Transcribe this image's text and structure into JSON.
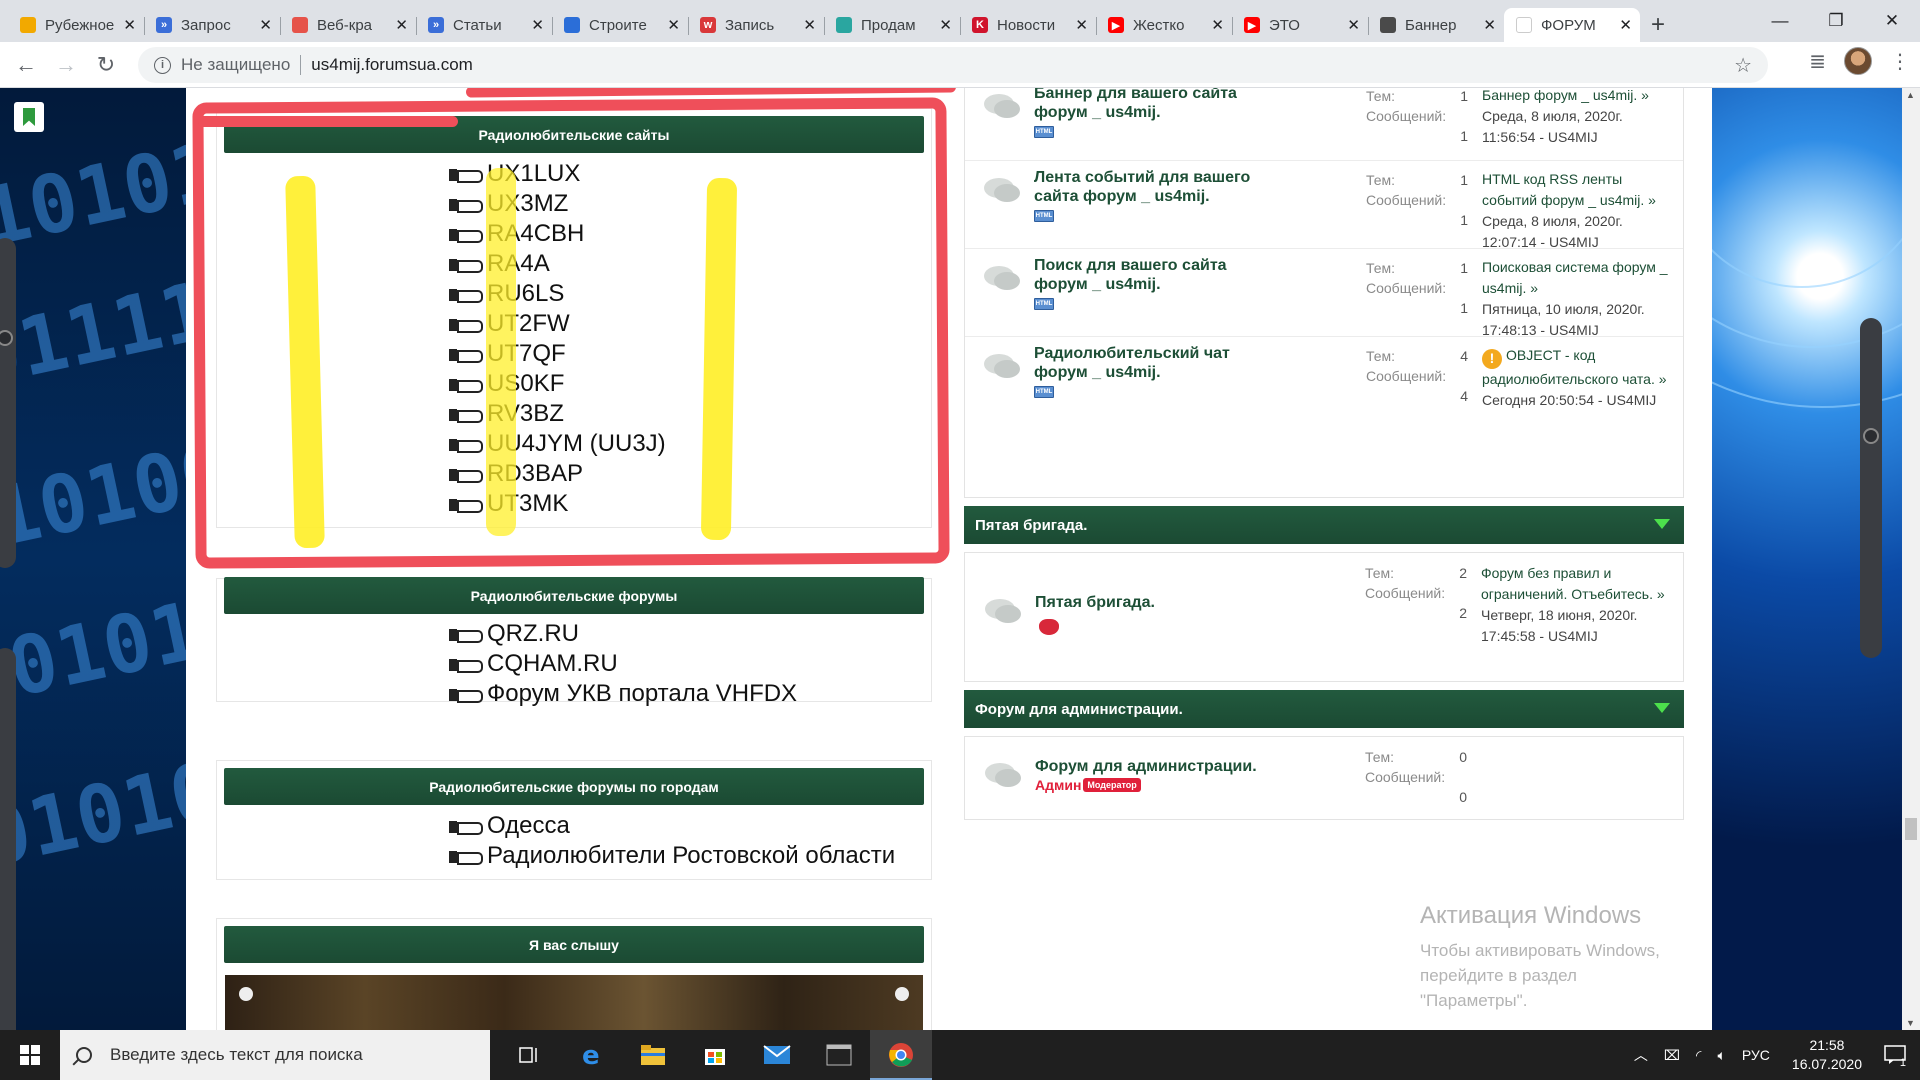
{
  "browser": {
    "tabs": [
      {
        "title": "Рубежное",
        "fav_color": "#f2a900",
        "fav_char": ""
      },
      {
        "title": "Запрос",
        "fav_color": "#3b6ed8",
        "fav_char": "»"
      },
      {
        "title": "Веб-кра",
        "fav_color": "#e6534a",
        "fav_char": ""
      },
      {
        "title": "Статьи",
        "fav_color": "#3b6ed8",
        "fav_char": "»"
      },
      {
        "title": "Строите",
        "fav_color": "#2b6ed8",
        "fav_char": ""
      },
      {
        "title": "Запись",
        "fav_color": "#d9383a",
        "fav_char": "w"
      },
      {
        "title": "Продам",
        "fav_color": "#2aa6a0",
        "fav_char": ""
      },
      {
        "title": "Новости",
        "fav_color": "#d0142c",
        "fav_char": "K"
      },
      {
        "title": "Жестко",
        "fav_color": "#ff0000",
        "fav_char": "▶"
      },
      {
        "title": "ЭТО",
        "fav_color": "#ff0000",
        "fav_char": "▶"
      },
      {
        "title": "Баннер",
        "fav_color": "#4a4a4a",
        "fav_char": ""
      },
      {
        "title": "ФОРУМ",
        "fav_color": "#ffffff",
        "fav_char": ""
      }
    ],
    "active_tab": 11,
    "new_tab": "+",
    "window_controls": {
      "minimize": "—",
      "maximize": "❐",
      "close": "✕"
    },
    "address": {
      "security": "Не защищено",
      "url": "us4mij.forumsua.com"
    }
  },
  "left_blocks": [
    {
      "title": "Радиолюбительские сайты",
      "links": [
        "UX1LUX",
        "UX3MZ",
        "RA4CBH",
        "RA4A",
        "RU6LS",
        "UT2FW",
        "UT7QF",
        "US0KF",
        "RV3BZ",
        "UU4JYM (UU3J)",
        "RD3BAP",
        "UT3MK"
      ]
    },
    {
      "title": "Радиолюбительские форумы",
      "links": [
        "QRZ.RU",
        "CQHAM.RU",
        "Форум УКВ портала VHFDX"
      ]
    },
    {
      "title": "Радиолюбительские форумы по городам",
      "links": [
        "Одесса",
        "Радиолюбители Ростовской области"
      ]
    },
    {
      "title": "Я вас слышу",
      "links": []
    }
  ],
  "stats_labels": {
    "topics": "Тем:",
    "messages": "Сообщений:"
  },
  "forums_top": [
    {
      "title": "Баннер для вашего сайта форум _ us4mij.",
      "topics": "1",
      "messages": "1",
      "last_title": "Баннер форум _ us4mij. »",
      "last_date": "Среда, 8 июля, 2020г.",
      "last_time": "11:56:54 - US4MIJ",
      "badge": "html"
    },
    {
      "title": "Лента событий для вашего сайта форум _ us4mij.",
      "topics": "1",
      "messages": "1",
      "last_title": "HTML код RSS ленты событий форум _ us4mij. »",
      "last_date": "Среда, 8 июля, 2020г.",
      "last_time": "12:07:14 - US4MIJ",
      "badge": "html"
    },
    {
      "title": "Поиск для вашего сайта форум _ us4mij.",
      "topics": "1",
      "messages": "1",
      "last_title": "Поисковая система форум _ us4mij. »",
      "last_date": "Пятница, 10 июля, 2020г.",
      "last_time": "17:48:13 - US4MIJ",
      "badge": "html"
    },
    {
      "title": "Радиолюбительский чат форум _ us4mij.",
      "topics": "4",
      "messages": "4",
      "last_title": "OBJECT - код радиолюбительского чата. »",
      "last_date": "",
      "last_time": "Сегодня 20:50:54 - US4MIJ",
      "badge": "html",
      "warn": "!"
    }
  ],
  "categories": [
    {
      "title": "Пятая бригада.",
      "forum": {
        "title": "Пятая бригада.",
        "topics": "2",
        "messages": "2",
        "last_title": "Форум без правил и ограничений. Отъебитесь. »",
        "last_date": "Четверг, 18 июня, 2020г.",
        "last_time": "17:45:58 - US4MIJ"
      }
    },
    {
      "title": "Форум для администрации.",
      "forum": {
        "title": "Форум для администрации.",
        "topics": "0",
        "messages": "0",
        "admin_label": "Админ",
        "mod_label": "Модератор"
      }
    }
  ],
  "html_badge_text": "HTML",
  "watermark": {
    "title": "Активация Windows",
    "line1": "Чтобы активировать Windows, перейдите в раздел",
    "line2": "\"Параметры\"."
  },
  "taskbar": {
    "search_placeholder": "Введите здесь текст для поиска",
    "lang": "РУС",
    "time": "21:58",
    "date": "16.07.2020",
    "notifications": "1"
  },
  "colors": {
    "accent_green": "#1d4f36",
    "annot_red": "#ef4f5a",
    "annot_yellow": "#ffef2a"
  }
}
